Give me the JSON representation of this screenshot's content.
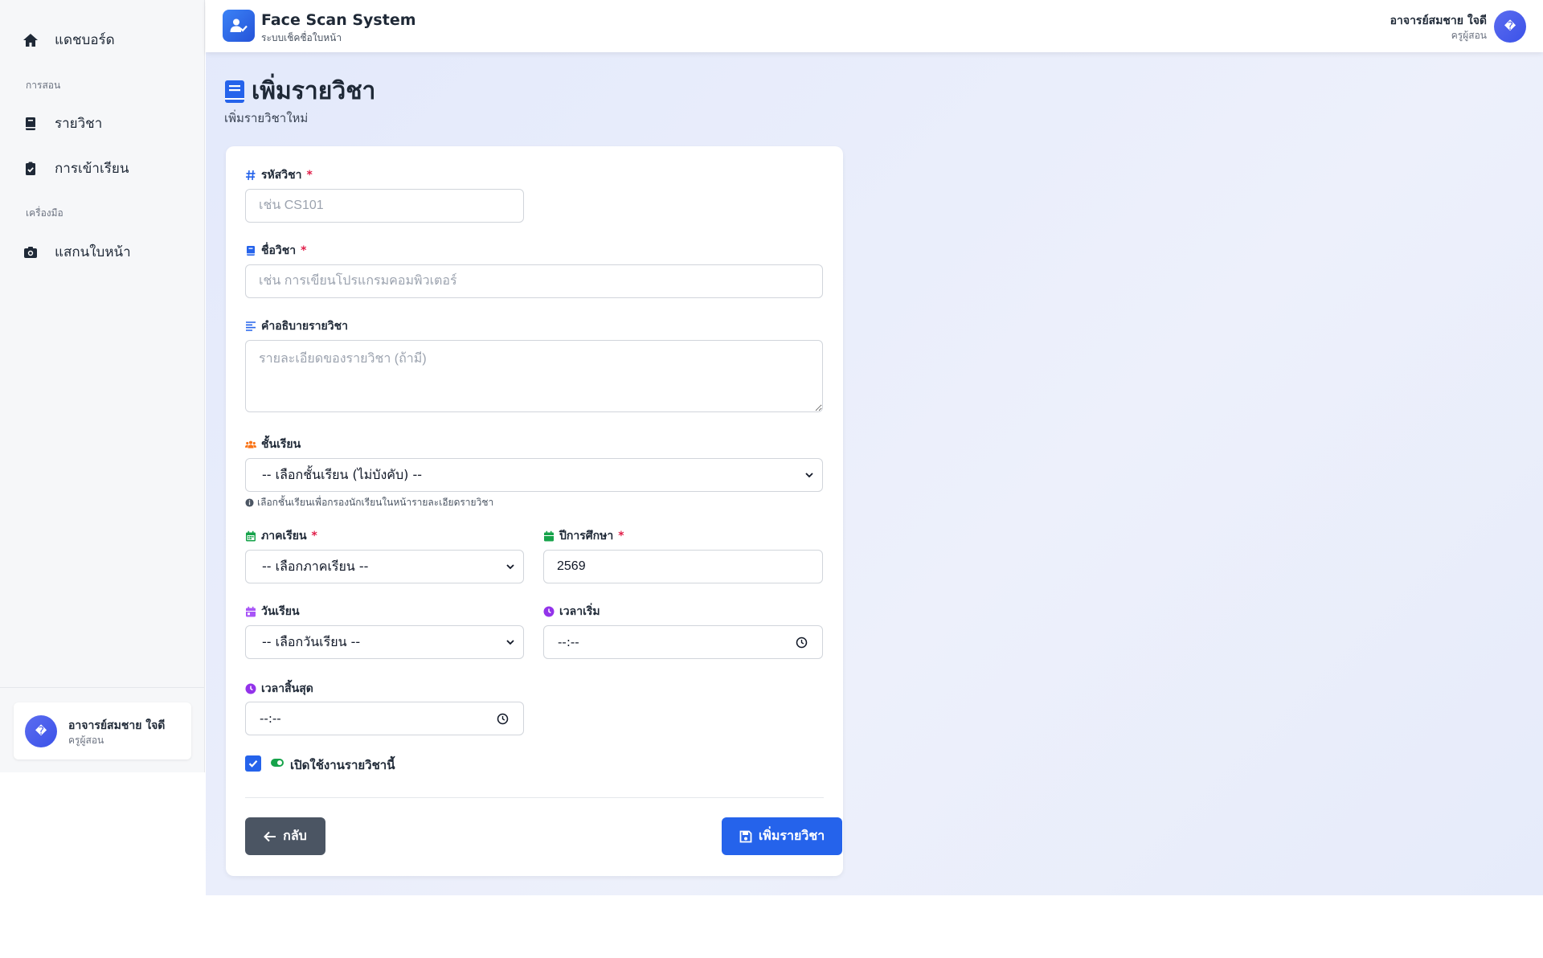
{
  "sidebar": {
    "dashboard": "แดชบอร์ด",
    "section_teaching": "การสอน",
    "courses": "รายวิชา",
    "attendance": "การเข้าเรียน",
    "section_tools": "เครื่องมือ",
    "face_scan": "แสกนใบหน้า",
    "user_name": "อาจารย์สมชาย ใจดี",
    "user_role": "ครูผู้สอน",
    "avatar_glyph": "�"
  },
  "topbar": {
    "app_title": "Face Scan System",
    "app_subtitle": "ระบบเช็คชื่อใบหน้า",
    "user_name": "อาจารย์สมชาย ใจดี",
    "user_role": "ครูผู้สอน",
    "avatar_glyph": "�"
  },
  "page": {
    "title": "เพิ่มรายวิชา",
    "subtitle": "เพิ่มรายวิชาใหม่"
  },
  "form": {
    "course_code": {
      "label": "รหัสวิชา",
      "required": "*",
      "placeholder": "เช่น CS101",
      "value": ""
    },
    "course_name": {
      "label": "ชื่อวิชา",
      "required": "*",
      "placeholder": "เช่น การเขียนโปรแกรมคอมพิวเตอร์",
      "value": ""
    },
    "description": {
      "label": "คำอธิบายรายวิชา",
      "placeholder": "รายละเอียดของรายวิชา (ถ้ามี)",
      "value": ""
    },
    "class_level": {
      "label": "ชั้นเรียน",
      "selected": "-- เลือกชั้นเรียน (ไม่บังคับ) --",
      "hint": "เลือกชั้นเรียนเพื่อกรองนักเรียนในหน้ารายละเอียดรายวิชา"
    },
    "semester": {
      "label": "ภาคเรียน",
      "required": "*",
      "selected": "-- เลือกภาคเรียน --"
    },
    "academic_year": {
      "label": "ปีการศึกษา",
      "required": "*",
      "value": "2569"
    },
    "study_day": {
      "label": "วันเรียน",
      "selected": "-- เลือกวันเรียน --"
    },
    "start_time": {
      "label": "เวลาเริ่ม",
      "value": "--:--"
    },
    "end_time": {
      "label": "เวลาสิ้นสุด",
      "value": "--:--"
    },
    "enable": {
      "label": "เปิดใช้งานรายวิชานี้",
      "checked": true
    },
    "back_button": "กลับ",
    "save_button": "เพิ่มรายวิชา"
  },
  "colors": {
    "primary": "#2563eb",
    "back_button": "#4b5563",
    "required": "#e11d48",
    "icon_orange": "#f97316",
    "icon_green": "#16a34a",
    "icon_purple": "#9333ea"
  }
}
